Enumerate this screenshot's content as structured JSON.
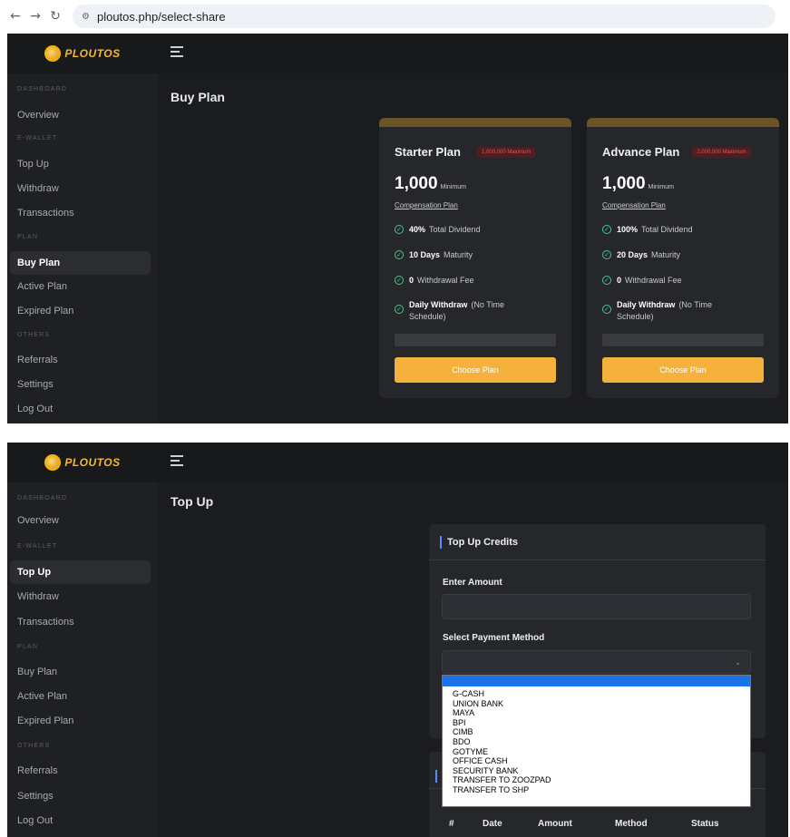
{
  "browser": {
    "url": "ploutos.php/select-share"
  },
  "brand": {
    "name": "PLOUTOS",
    "accent": "#f4b23c"
  },
  "sidebar": {
    "sections": [
      "DASHBOARD",
      "E-WALLET",
      "PLAN",
      "OTHERS"
    ],
    "items": [
      "Overview",
      "Top Up",
      "Withdraw",
      "Transactions",
      "Buy Plan",
      "Active Plan",
      "Expired Plan",
      "Referrals",
      "Settings",
      "Log Out"
    ]
  },
  "screen1": {
    "title": "Buy Plan",
    "active_item": "Buy Plan",
    "plans": [
      {
        "name": "Starter Plan",
        "badge": "1,000,000 Maximum",
        "amount": "1,000",
        "min_label": "Minimum",
        "link": "Compensation Plan",
        "features": [
          {
            "bold": "40%",
            "text": "Total Dividend"
          },
          {
            "bold": "10 Days",
            "text": "Maturity"
          },
          {
            "bold": "0",
            "text": "Withdrawal Fee"
          },
          {
            "bold": "Daily Withdraw",
            "text": "(No Time Schedule)"
          }
        ],
        "button": "Choose Plan"
      },
      {
        "name": "Advance Plan",
        "badge": "2,000,000 Maximum",
        "amount": "1,000",
        "min_label": "Minimum",
        "link": "Compensation Plan",
        "features": [
          {
            "bold": "100%",
            "text": "Total Dividend"
          },
          {
            "bold": "20 Days",
            "text": "Maturity"
          },
          {
            "bold": "0",
            "text": "Withdrawal Fee"
          },
          {
            "bold": "Daily Withdraw",
            "text": "(No Time Schedule)"
          }
        ],
        "button": "Choose Plan"
      }
    ]
  },
  "screen2": {
    "title": "Top Up",
    "active_item": "Top Up",
    "card_title": "Top Up Credits",
    "amount_label": "Enter Amount",
    "amount_value": "",
    "method_label": "Select Payment Method",
    "method_value": "",
    "options": [
      "G-CASH",
      "UNION BANK",
      "MAYA",
      "BPI",
      "CIMB",
      "BDO",
      "GOTYME",
      "OFFICE CASH",
      "SECURITY BANK",
      "TRANSFER TO ZOOZPAD",
      "TRANSFER TO SHP"
    ],
    "table_headers": [
      "#",
      "Date",
      "Amount",
      "Method",
      "Status"
    ]
  }
}
